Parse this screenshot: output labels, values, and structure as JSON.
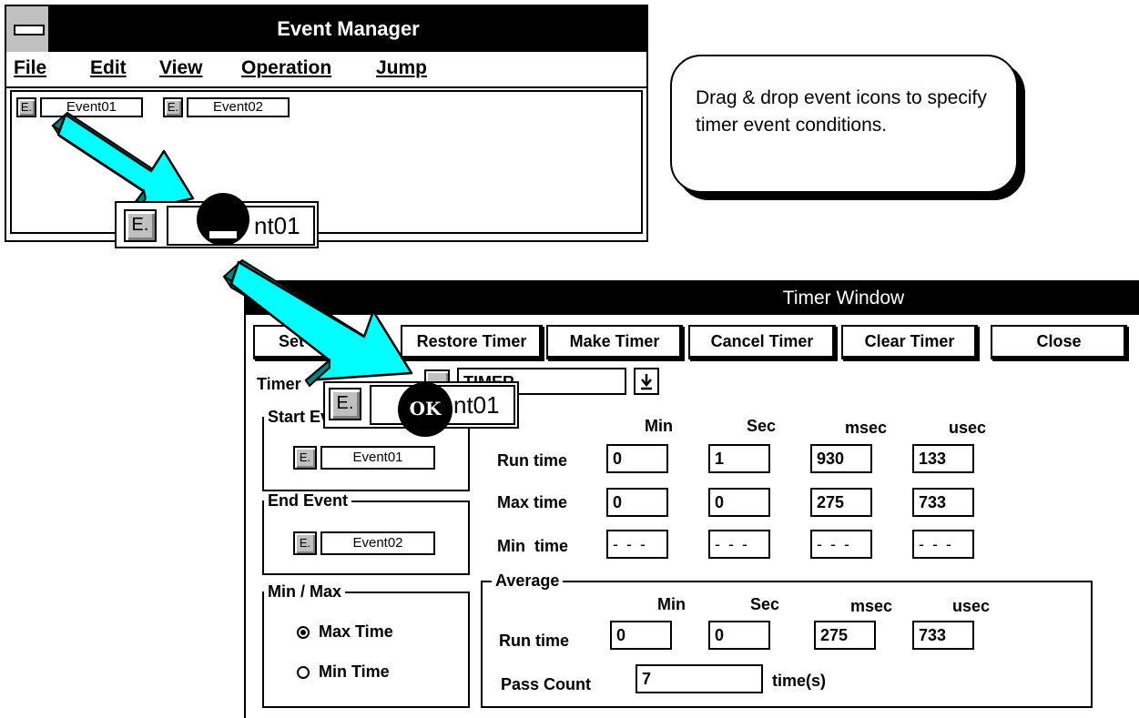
{
  "event_manager": {
    "title": "Event Manager",
    "menu": [
      "File",
      "Edit",
      "View",
      "Operation",
      "Jump"
    ],
    "events": [
      {
        "icon": "E.",
        "label": "Event01"
      },
      {
        "icon": "E.",
        "label": "Event02"
      }
    ]
  },
  "callout": {
    "text": "Drag & drop event icons to specify timer event conditions."
  },
  "drag_items": [
    {
      "icon": "E.",
      "label": "Event01",
      "visible_label": "nt01",
      "cursor": "not-allowed"
    },
    {
      "icon": "E.",
      "label": "Event01",
      "visible_label": "nt01",
      "cursor": "ok",
      "cursor_text": "OK"
    }
  ],
  "timer_window": {
    "title": "Timer Window",
    "buttons": [
      "Set",
      "Restore Timer",
      "Make Timer",
      "Cancel Timer",
      "Clear Timer",
      "Close"
    ],
    "timer_label": "Timer",
    "timer_value": "TIMER",
    "dropdown_icon": "down-arrow-icon",
    "start_event": {
      "title": "Start Event",
      "icon": "E.",
      "event": "Event01"
    },
    "end_event": {
      "title": "End Event",
      "icon": "E.",
      "event": "Event02"
    },
    "columns": [
      "Min",
      "Sec",
      "msec",
      "usec"
    ],
    "rows": [
      {
        "label": "Run time",
        "values": [
          "0",
          "1",
          "930",
          "133"
        ]
      },
      {
        "label": "Max time",
        "values": [
          "0",
          "0",
          "275",
          "733"
        ]
      },
      {
        "label": "Min  time",
        "values": [
          "- - -",
          "- - -",
          "- - -",
          "- - -"
        ]
      }
    ],
    "min_max": {
      "title": "Min / Max",
      "options": [
        "Max Time",
        "Min Time"
      ],
      "selected": "Max Time"
    },
    "average": {
      "title": "Average",
      "columns": [
        "Min",
        "Sec",
        "msec",
        "usec"
      ],
      "run_time_label": "Run time",
      "run_time": [
        "0",
        "0",
        "275",
        "733"
      ],
      "pass_count_label": "Pass Count",
      "pass_count": "7",
      "pass_count_unit": "time(s)"
    }
  },
  "colors": {
    "arrow_face": "#00ffff",
    "arrow_side": "#008080",
    "button_face": "#c0c0c0"
  }
}
